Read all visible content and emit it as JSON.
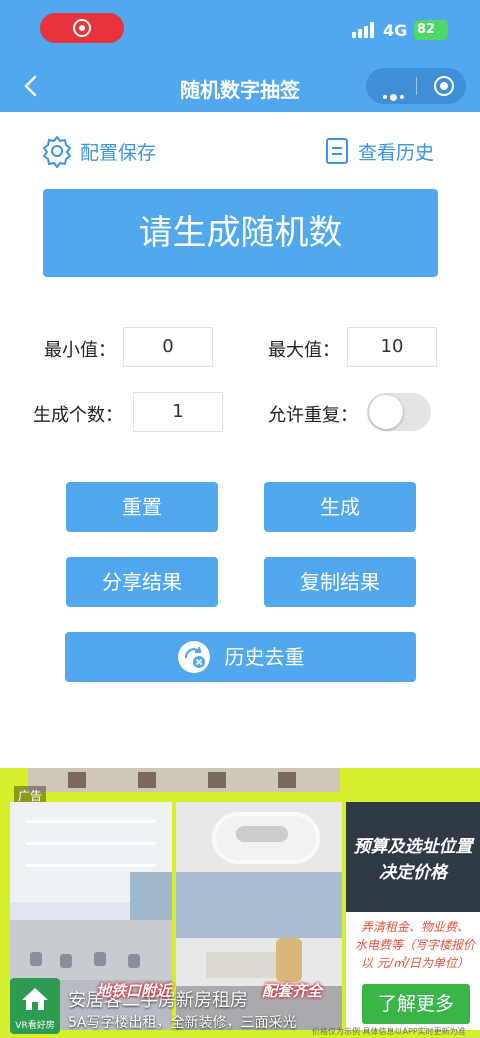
{
  "status": {
    "network": "4G",
    "battery": "82"
  },
  "nav": {
    "title": "随机数字抽签"
  },
  "links": {
    "config_save": "配置保存",
    "history": "查看历史"
  },
  "banner": {
    "text": "请生成随机数"
  },
  "form": {
    "min_label": "最小值：",
    "min_value": "0",
    "max_label": "最大值：",
    "max_value": "10",
    "count_label": "生成个数：",
    "count_value": "1",
    "repeat_label": "允许重复：",
    "repeat_enabled": false
  },
  "buttons": {
    "reset": "重置",
    "generate": "生成",
    "share": "分享结果",
    "copy": "复制结果",
    "dedupe": "历史去重"
  },
  "ad": {
    "tag": "广告",
    "headline_1": "预算及选址位置",
    "headline_2": "决定价格",
    "desc_1": "弄清租金、物业费、",
    "desc_2": "水电费等（写字楼报价",
    "desc_3": "以 元/㎡/日为单位）",
    "caption": "安居客二手房新房租房",
    "subcaption": "5A写字楼出租，全新装修，三面采光",
    "tag_a": "地铁口附近",
    "tag_b": "配套齐全",
    "badge": "VR看好房",
    "cta": "了解更多",
    "footnote": "价格仅为示例 具体信息以APP实时更新为准"
  }
}
